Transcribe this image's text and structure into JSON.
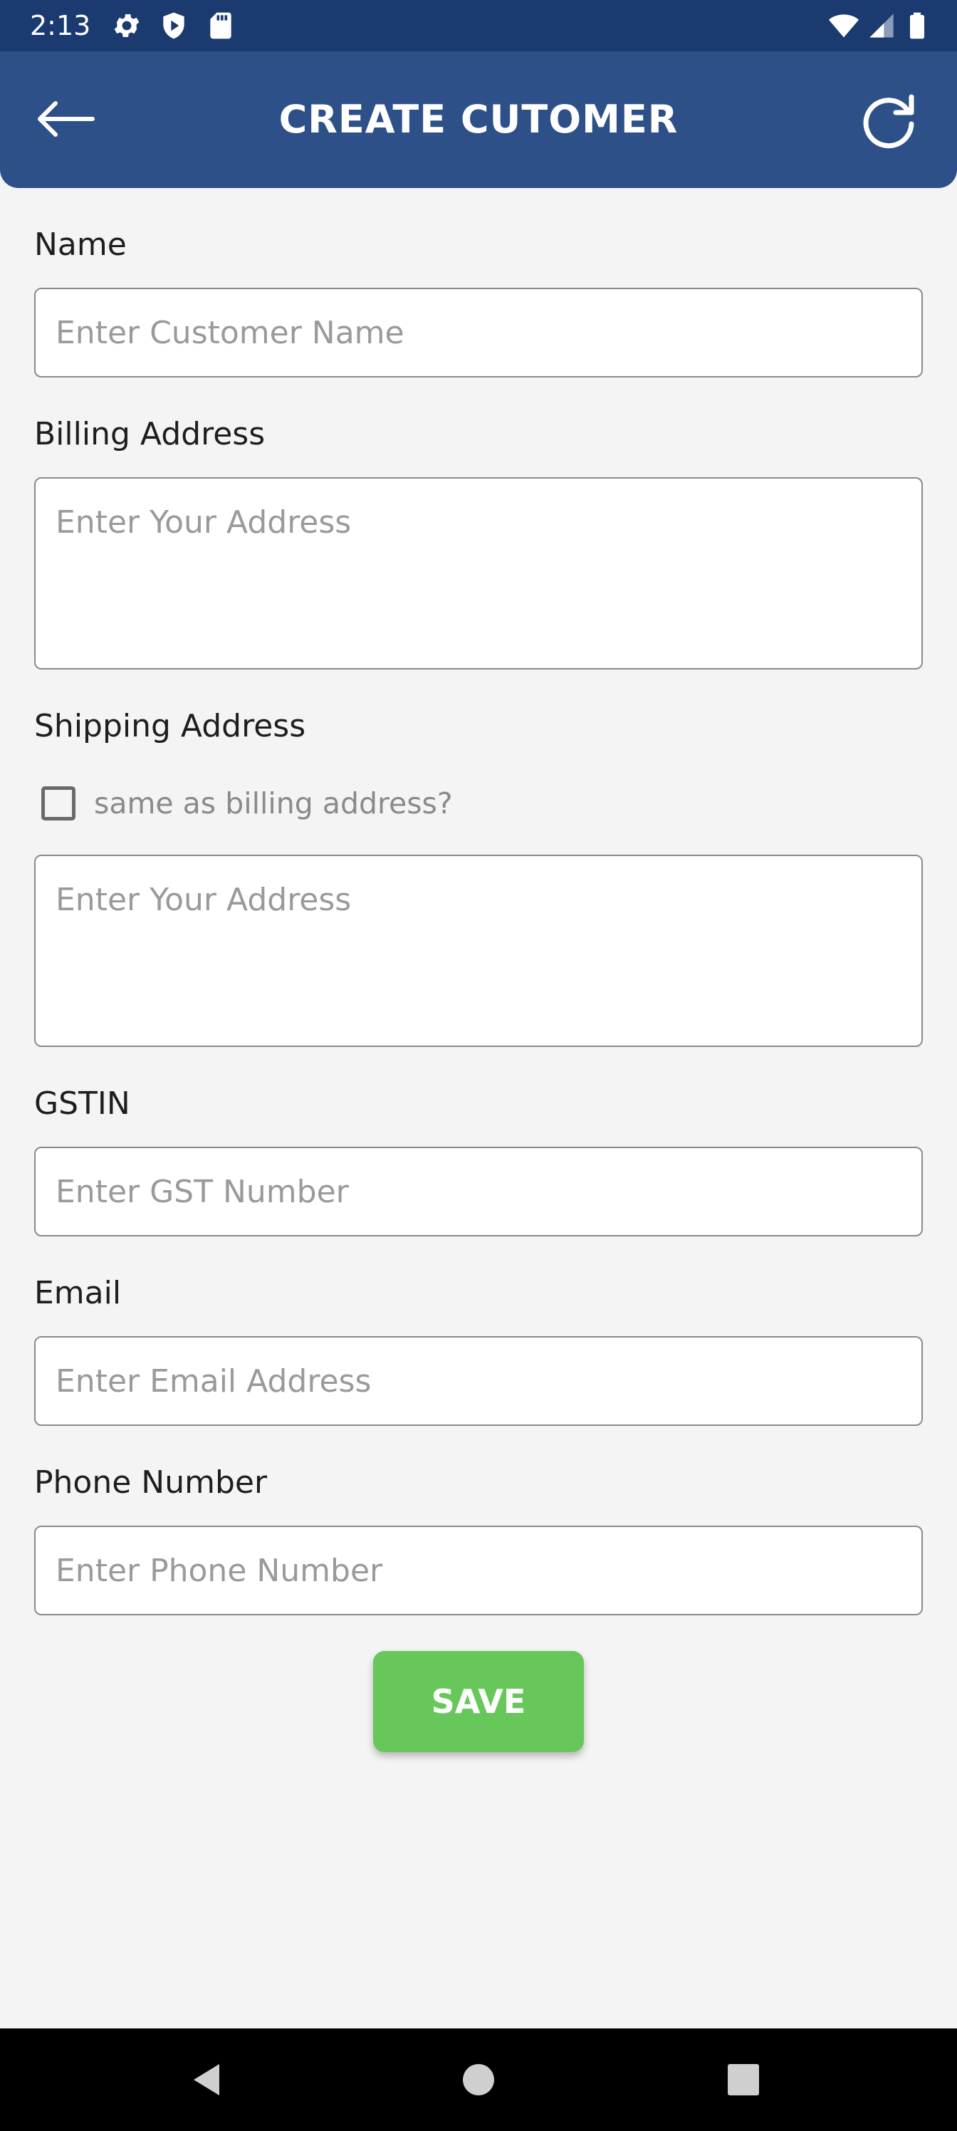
{
  "status_bar": {
    "time": "2:13",
    "icons": [
      "gear-icon",
      "shield-play-icon",
      "sd-card-icon",
      "wifi-icon",
      "signal-icon",
      "battery-icon"
    ]
  },
  "app_bar": {
    "title": "CREATE CUTOMER",
    "background": "#2d5088",
    "back_icon": "arrow-left-icon",
    "refresh_icon": "refresh-icon"
  },
  "form": {
    "name": {
      "label": "Name",
      "placeholder": "Enter Customer Name",
      "value": ""
    },
    "billing_address": {
      "label": "Billing Address",
      "placeholder": "Enter Your Address",
      "value": ""
    },
    "shipping_address": {
      "label": "Shipping Address",
      "same_as_billing_label": "same as billing address?",
      "same_as_billing_checked": false,
      "placeholder": "Enter Your Address",
      "value": ""
    },
    "gstin": {
      "label": "GSTIN",
      "placeholder": "Enter GST Number",
      "value": ""
    },
    "email": {
      "label": "Email",
      "placeholder": "Enter Email Address",
      "value": ""
    },
    "phone": {
      "label": "Phone Number",
      "placeholder": "Enter Phone Number",
      "value": ""
    },
    "save_label": "SAVE",
    "save_color": "#67c75a"
  },
  "nav_bar": {
    "icons": [
      "back-triangle-icon",
      "home-circle-icon",
      "recents-square-icon"
    ]
  }
}
